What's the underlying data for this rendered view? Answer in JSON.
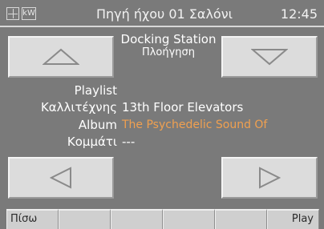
{
  "header": {
    "icon_grid": "grid-icon",
    "icon_kw": "kW",
    "title": "Πηγή ήχου 01 Σαλόνι",
    "clock": "12:45"
  },
  "source": {
    "name": "Docking Station",
    "mode": "Πλοήγηση"
  },
  "track_info": {
    "playlist_label": "Playlist",
    "playlist_value": "",
    "artist_label": "Καλλιτέχνης",
    "artist_value": "13th Floor Elevators",
    "album_label": "Album",
    "album_value": "The Psychedelic Sound Of",
    "track_label": "Κομμάτι",
    "track_value": "---"
  },
  "buttons": {
    "up": "triangle-up-icon",
    "down": "triangle-down-icon",
    "prev": "triangle-left-icon",
    "next": "triangle-right-icon"
  },
  "softkeys": [
    "Πίσω",
    "",
    "",
    "",
    "",
    "Play"
  ],
  "colors": {
    "background": "#7a7a7a",
    "button": "#dcdcdc",
    "accent": "#f0a050",
    "text": "#ffffff"
  }
}
